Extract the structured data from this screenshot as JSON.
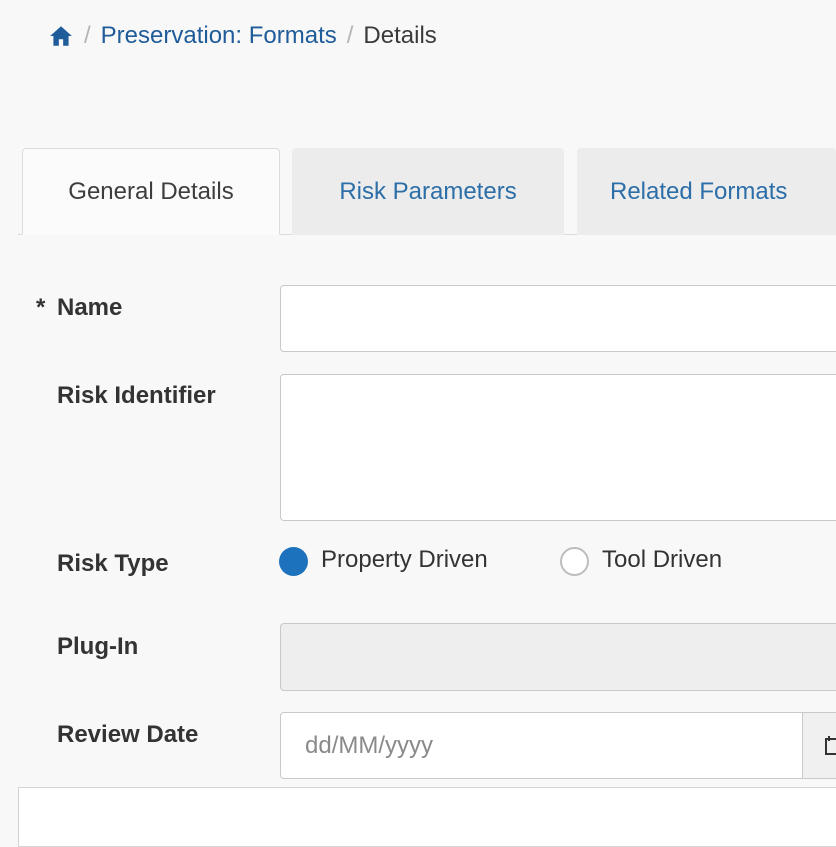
{
  "breadcrumb": {
    "home_icon": "home-icon",
    "separator": "/",
    "link": "Preservation: Formats",
    "current": "Details"
  },
  "tabs": [
    {
      "label": "General Details",
      "active": true
    },
    {
      "label": "Risk Parameters",
      "active": false
    },
    {
      "label": "Related Formats",
      "active": false
    }
  ],
  "form": {
    "name": {
      "required_marker": "*",
      "label": "Name",
      "value": ""
    },
    "risk_identifier": {
      "label": "Risk Identifier",
      "value": ""
    },
    "risk_type": {
      "label": "Risk Type",
      "options": [
        {
          "label": "Property Driven",
          "selected": true
        },
        {
          "label": "Tool Driven",
          "selected": false
        }
      ]
    },
    "plugin": {
      "label": "Plug-In",
      "value": ""
    },
    "review_date": {
      "label": "Review Date",
      "placeholder": "dd/MM/yyyy",
      "button_icon": "calendar-icon"
    }
  },
  "colors": {
    "link": "#1f5c99",
    "tab_text": "#2c6ea8",
    "radio_selected": "#1c72bd"
  }
}
